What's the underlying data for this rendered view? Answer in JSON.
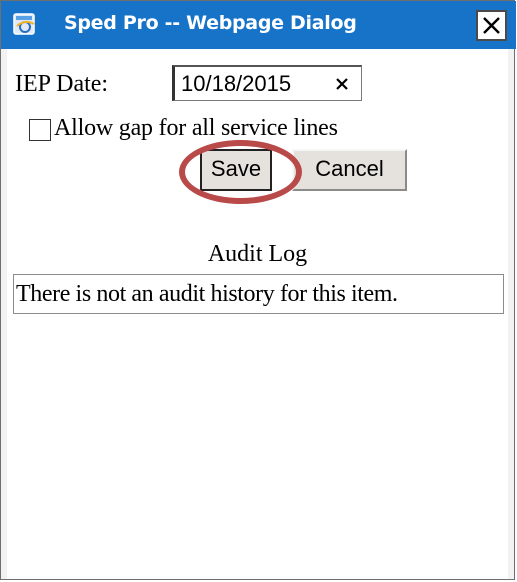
{
  "window": {
    "title": "Sped Pro -- Webpage Dialog",
    "icon": "ie-window-icon",
    "close_icon": "close-icon",
    "titlebar_color": "#1673c8"
  },
  "form": {
    "iep_date_label": "IEP Date:",
    "iep_date_value": "10/18/2015",
    "clear_icon": "×",
    "allow_gap_label": "Allow gap for all service lines",
    "allow_gap_checked": false
  },
  "buttons": {
    "save_label": "Save",
    "cancel_label": "Cancel"
  },
  "annotation": {
    "highlight_color": "#b84a4a",
    "highlight_target": "save-button"
  },
  "audit": {
    "heading": "Audit Log",
    "message": "There is not an audit history for this item."
  }
}
